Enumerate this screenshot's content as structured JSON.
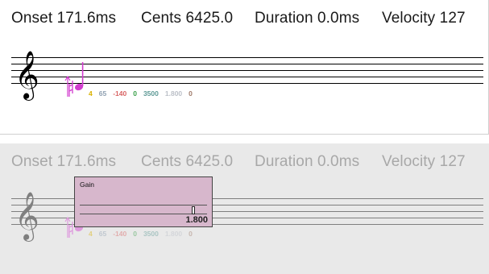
{
  "event_info": {
    "onset": "Onset 171.6ms",
    "cents": "Cents 6425.0",
    "duration": "Duration 0.0ms",
    "velocity": "Velocity 127"
  },
  "note_params": [
    {
      "value": "4",
      "color": "#d9b100"
    },
    {
      "value": "65",
      "color": "#8e9fb0"
    },
    {
      "value": "-140",
      "color": "#d86464"
    },
    {
      "value": "0",
      "color": "#3aa04a"
    },
    {
      "value": "3500",
      "color": "#5e9a96"
    },
    {
      "value": "1.800",
      "color": "#bcc0c8"
    },
    {
      "value": "0",
      "color": "#a07b6a"
    }
  ],
  "gain_popup": {
    "title": "Gain",
    "value": "1.800",
    "level_fraction": 0.9
  },
  "colors": {
    "note": "#d23ccf",
    "popup_bg": "#d7b7cc",
    "faded_panel": "#e9e9e9"
  },
  "icons": [
    "treble-clef-icon",
    "natural-sign-icon",
    "cents-up-arrow-icon"
  ]
}
